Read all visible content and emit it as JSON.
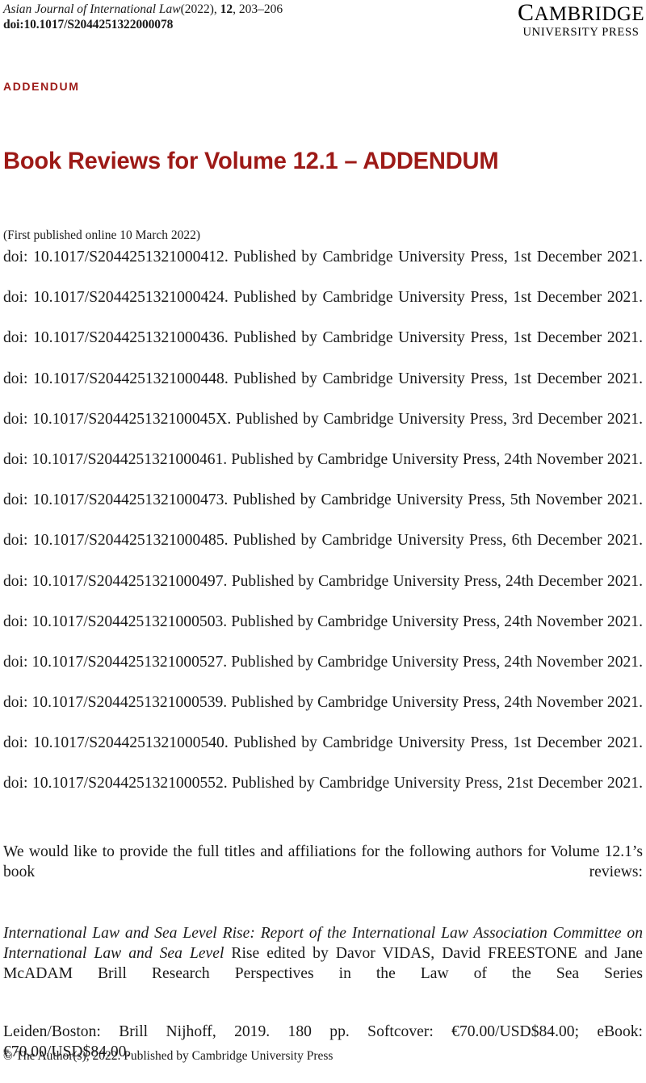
{
  "header": {
    "journal_name": "Asian Journal of International Law",
    "year": "(2022),",
    "volume": "12",
    "pages": ", 203–206",
    "doi_line": "doi:10.1017/S2044251322000078",
    "publisher_logo": {
      "line1_cap": "C",
      "line1_rest": "AMBRIDGE",
      "line2": "UNIVERSITY PRESS"
    }
  },
  "section_tag": "ADDENDUM",
  "title": "Book Reviews for Volume 12.1 – ADDENDUM",
  "publication_note": "(First published online 10 March 2022)",
  "doi_entries": [
    "doi: 10.1017/S2044251321000412. Published by Cambridge University Press, 1st December 2021.",
    "doi: 10.1017/S2044251321000424. Published by Cambridge University Press, 1st December 2021.",
    "doi: 10.1017/S2044251321000436. Published by Cambridge University Press, 1st December 2021.",
    "doi: 10.1017/S2044251321000448. Published by Cambridge University Press, 1st December 2021.",
    "doi: 10.1017/S204425132100045X. Published by Cambridge University Press, 3rd December 2021.",
    "doi: 10.1017/S2044251321000461. Published by Cambridge University Press, 24th November 2021.",
    "doi: 10.1017/S2044251321000473. Published by Cambridge University Press, 5th November 2021.",
    "doi: 10.1017/S2044251321000485. Published by Cambridge University Press, 6th December 2021.",
    "doi: 10.1017/S2044251321000497. Published by Cambridge University Press, 24th December 2021.",
    "doi: 10.1017/S2044251321000503. Published by Cambridge University Press, 24th November 2021.",
    "doi: 10.1017/S2044251321000527. Published by Cambridge University Press, 24th November 2021.",
    "doi: 10.1017/S2044251321000539. Published by Cambridge University Press, 24th November 2021.",
    "doi: 10.1017/S2044251321000540. Published by Cambridge University Press, 1st December 2021.",
    "doi: 10.1017/S2044251321000552. Published by Cambridge University Press, 21st December 2021."
  ],
  "intro_paragraph": "We would like to provide the full titles and affiliations for the following authors for Volume 12.1’s book reviews:",
  "book_entry": {
    "title_italic": "International Law and Sea Level Rise: Report of the International Law Association Committee on International Law and Sea Level",
    "title_rest": " Rise edited by Davor VIDAS, David FREESTONE and Jane McADAM Brill Research Perspectives in the Law of the Sea Series",
    "imprint": "Leiden/Boston: Brill Nijhoff, 2019. 180 pp. Softcover: €70.00/USD$84.00; eBook: €70.00/USD$84.00."
  },
  "footer": "© The Author(s), 2022. Published by Cambridge University Press",
  "colors": {
    "accent_red": "#9d1a17",
    "body_text": "#1a1a1a",
    "background": "#ffffff"
  }
}
